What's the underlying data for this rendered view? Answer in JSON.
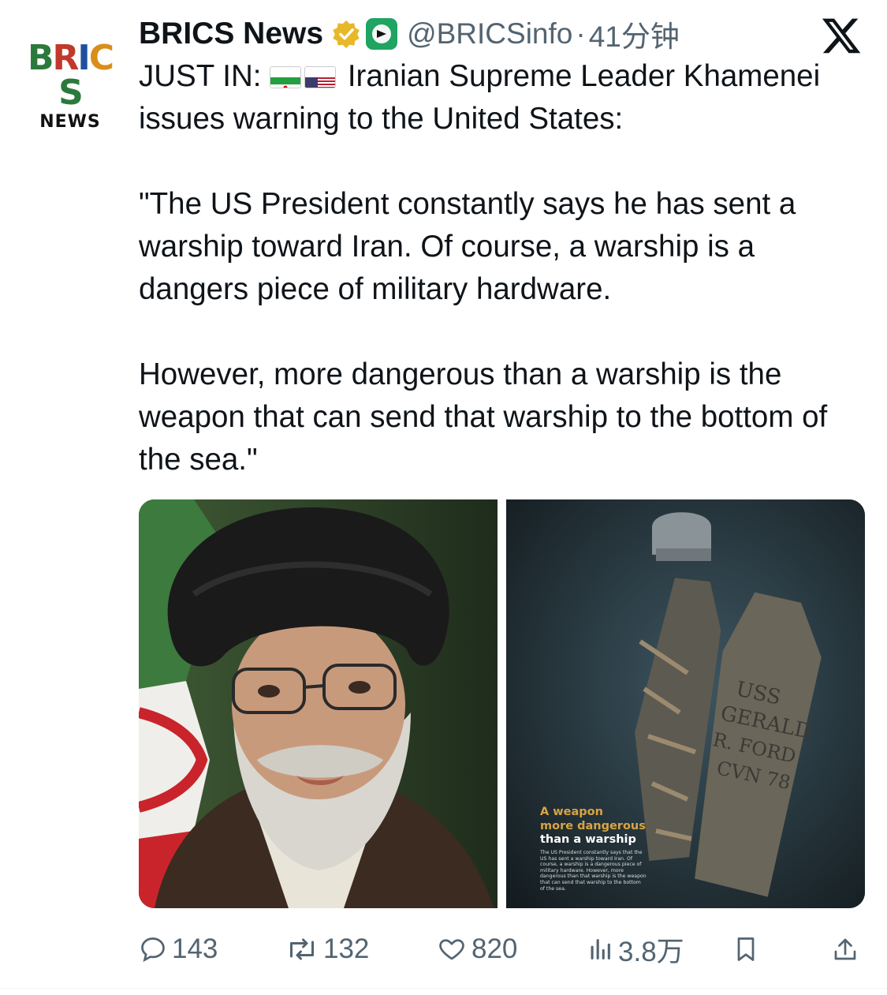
{
  "author": {
    "name": "BRICS News",
    "handle": "@BRICSinfo",
    "separator": "·",
    "time": "41分钟",
    "logo_text_main": "BRICS",
    "logo_text_sub": "NEWS"
  },
  "tweet": {
    "prefix": "JUST IN:",
    "flags": [
      "iran-flag",
      "us-flag"
    ],
    "line1_rest": "Iranian Supreme Leader Khamenei issues warning to the United States:",
    "paragraph2": "\"The US President constantly says he has sent a warship toward Iran. Of course, a warship is a dangers piece of military hardware.",
    "paragraph3": "However, more dangerous than a warship is the weapon that can send that warship to the bottom of the sea.\""
  },
  "media": {
    "left_image": "portrait-photo",
    "right_image": "sunken-carrier-poster",
    "poster_title_1": "A weapon",
    "poster_title_2": "more dangerous",
    "poster_title_3": "than a warship",
    "poster_body": "The US President constantly says that the US has sent a warship toward Iran. Of course, a warship is a dangerous piece of military hardware. However, more dangerous than that warship is the weapon that can send that warship to the bottom of the sea.",
    "ship_label_1": "USS",
    "ship_label_2": "GERALD",
    "ship_label_3": "R. FORD",
    "ship_label_4": "CVN 78"
  },
  "actions": {
    "replies": "143",
    "reposts": "132",
    "likes": "820",
    "views": "3.8万"
  },
  "colors": {
    "text": "#0f1419",
    "secondary": "#536471",
    "verified_gold": "#e8b829",
    "affiliate_green": "#1fa463"
  }
}
